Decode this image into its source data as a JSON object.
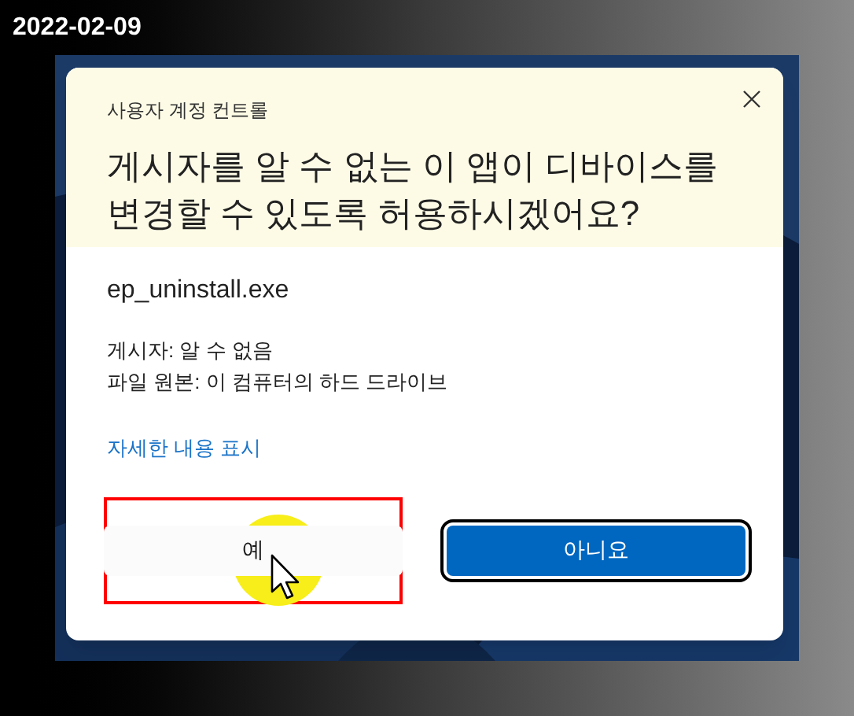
{
  "date": "2022-02-09",
  "dialog": {
    "title": "사용자 계정 컨트롤",
    "question": "게시자를 알 수 없는 이 앱이 디바이스를 변경할 수 있도록 허용하시겠어요?",
    "program": "ep_uninstall.exe",
    "details": [
      "게시자: 알 수 없음",
      "파일 원본: 이 컴퓨터의 하드 드라이브"
    ],
    "more_link": "자세한 내용 표시",
    "buttons": [
      {
        "label": "예",
        "kind": "secondary",
        "focused": false,
        "highlighted": true
      },
      {
        "label": "아니요",
        "kind": "primary",
        "focused": true,
        "highlighted": false
      }
    ]
  }
}
